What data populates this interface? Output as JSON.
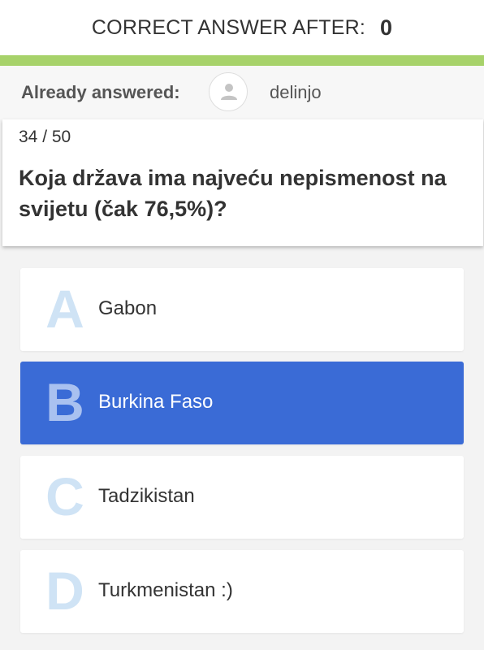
{
  "header": {
    "label": "CORRECT ANSWER AFTER:",
    "count": "0"
  },
  "answered": {
    "label": "Already answered:",
    "user": "delinjo"
  },
  "question": {
    "counter": "34 / 50",
    "text": "Koja država ima najveću nepismenost na svijetu (čak 76,5%)?"
  },
  "options": [
    {
      "letter": "A",
      "text": "Gabon",
      "selected": false
    },
    {
      "letter": "B",
      "text": "Burkina Faso",
      "selected": true
    },
    {
      "letter": "C",
      "text": "Tadzikistan",
      "selected": false
    },
    {
      "letter": "D",
      "text": "Turkmenistan :)",
      "selected": false
    }
  ],
  "colors": {
    "progress": "#a7d26a",
    "selected": "#3a6bd6",
    "letter": "#cfe3f5"
  }
}
